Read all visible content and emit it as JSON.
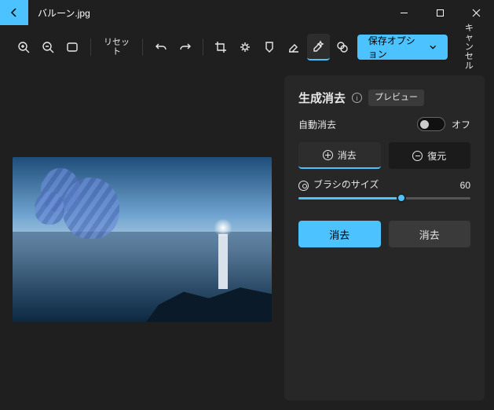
{
  "titlebar": {
    "filename": "バルーン.jpg"
  },
  "toolbar": {
    "reset_label": "リセット",
    "save_label": "保存オプション",
    "cancel_label": "キャンセル"
  },
  "panel": {
    "title": "生成消去",
    "preview_label": "プレビュー",
    "auto_erase_label": "自動消去",
    "auto_erase_state": "オフ",
    "mode_add": "消去",
    "mode_remove": "復元",
    "brush_label": "ブラシのサイズ",
    "brush_value": "60",
    "apply_label": "消去",
    "secondary_label": "消去"
  }
}
